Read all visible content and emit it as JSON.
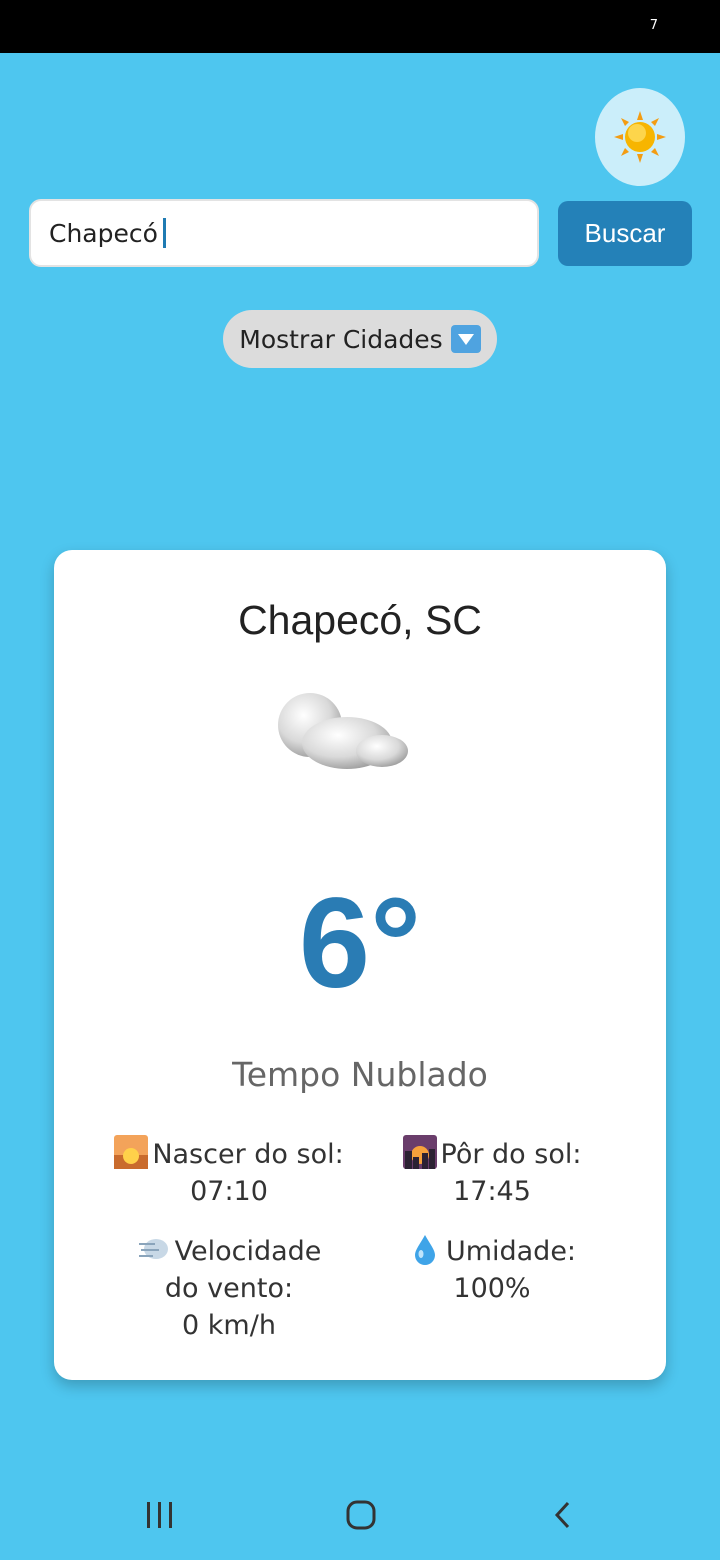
{
  "status_bar": {
    "glyph": "7"
  },
  "search": {
    "value": "Chapecó",
    "button_label": "Buscar"
  },
  "cities_toggle": {
    "label": "Mostrar Cidades"
  },
  "weather": {
    "city": "Chapecó, SC",
    "temperature": "6°",
    "condition": "Tempo Nublado",
    "sunrise_label": "Nascer do sol:",
    "sunrise_time": "07:10",
    "sunset_label": "Pôr do sol:",
    "sunset_time": "17:45",
    "wind_label_1": "Velocidade",
    "wind_label_2": "do vento:",
    "wind_value": "0 km/h",
    "humidity_label": "Umidade:",
    "humidity_value": "100%"
  },
  "colors": {
    "background": "#4ec6ef",
    "accent": "#2481b8",
    "temperature": "#2a7cb4"
  },
  "icons": [
    "sun-icon",
    "cloud-icon",
    "sunrise-icon",
    "sunset-icon",
    "wind-icon",
    "droplet-icon",
    "recent-apps-icon",
    "home-icon",
    "back-icon",
    "chevron-down-icon"
  ]
}
